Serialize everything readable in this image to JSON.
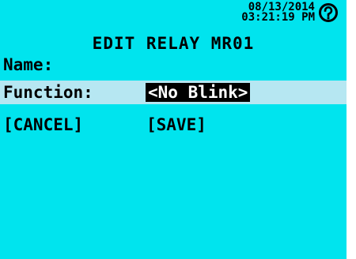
{
  "header": {
    "date": "08/13/2014",
    "time": "03:21:19 PM",
    "help_icon": "help-circle-icon"
  },
  "title": "EDIT RELAY MR01",
  "form": {
    "name_label": "Name:",
    "name_value": "",
    "function_label": "Function:",
    "function_value": "<No Blink>"
  },
  "buttons": {
    "cancel": "[CANCEL]",
    "save": "[SAVE]"
  },
  "colors": {
    "background": "#00e4ee",
    "highlight_row": "#b6e7f2",
    "selected_bg": "#000000",
    "selected_fg": "#ffffff"
  }
}
